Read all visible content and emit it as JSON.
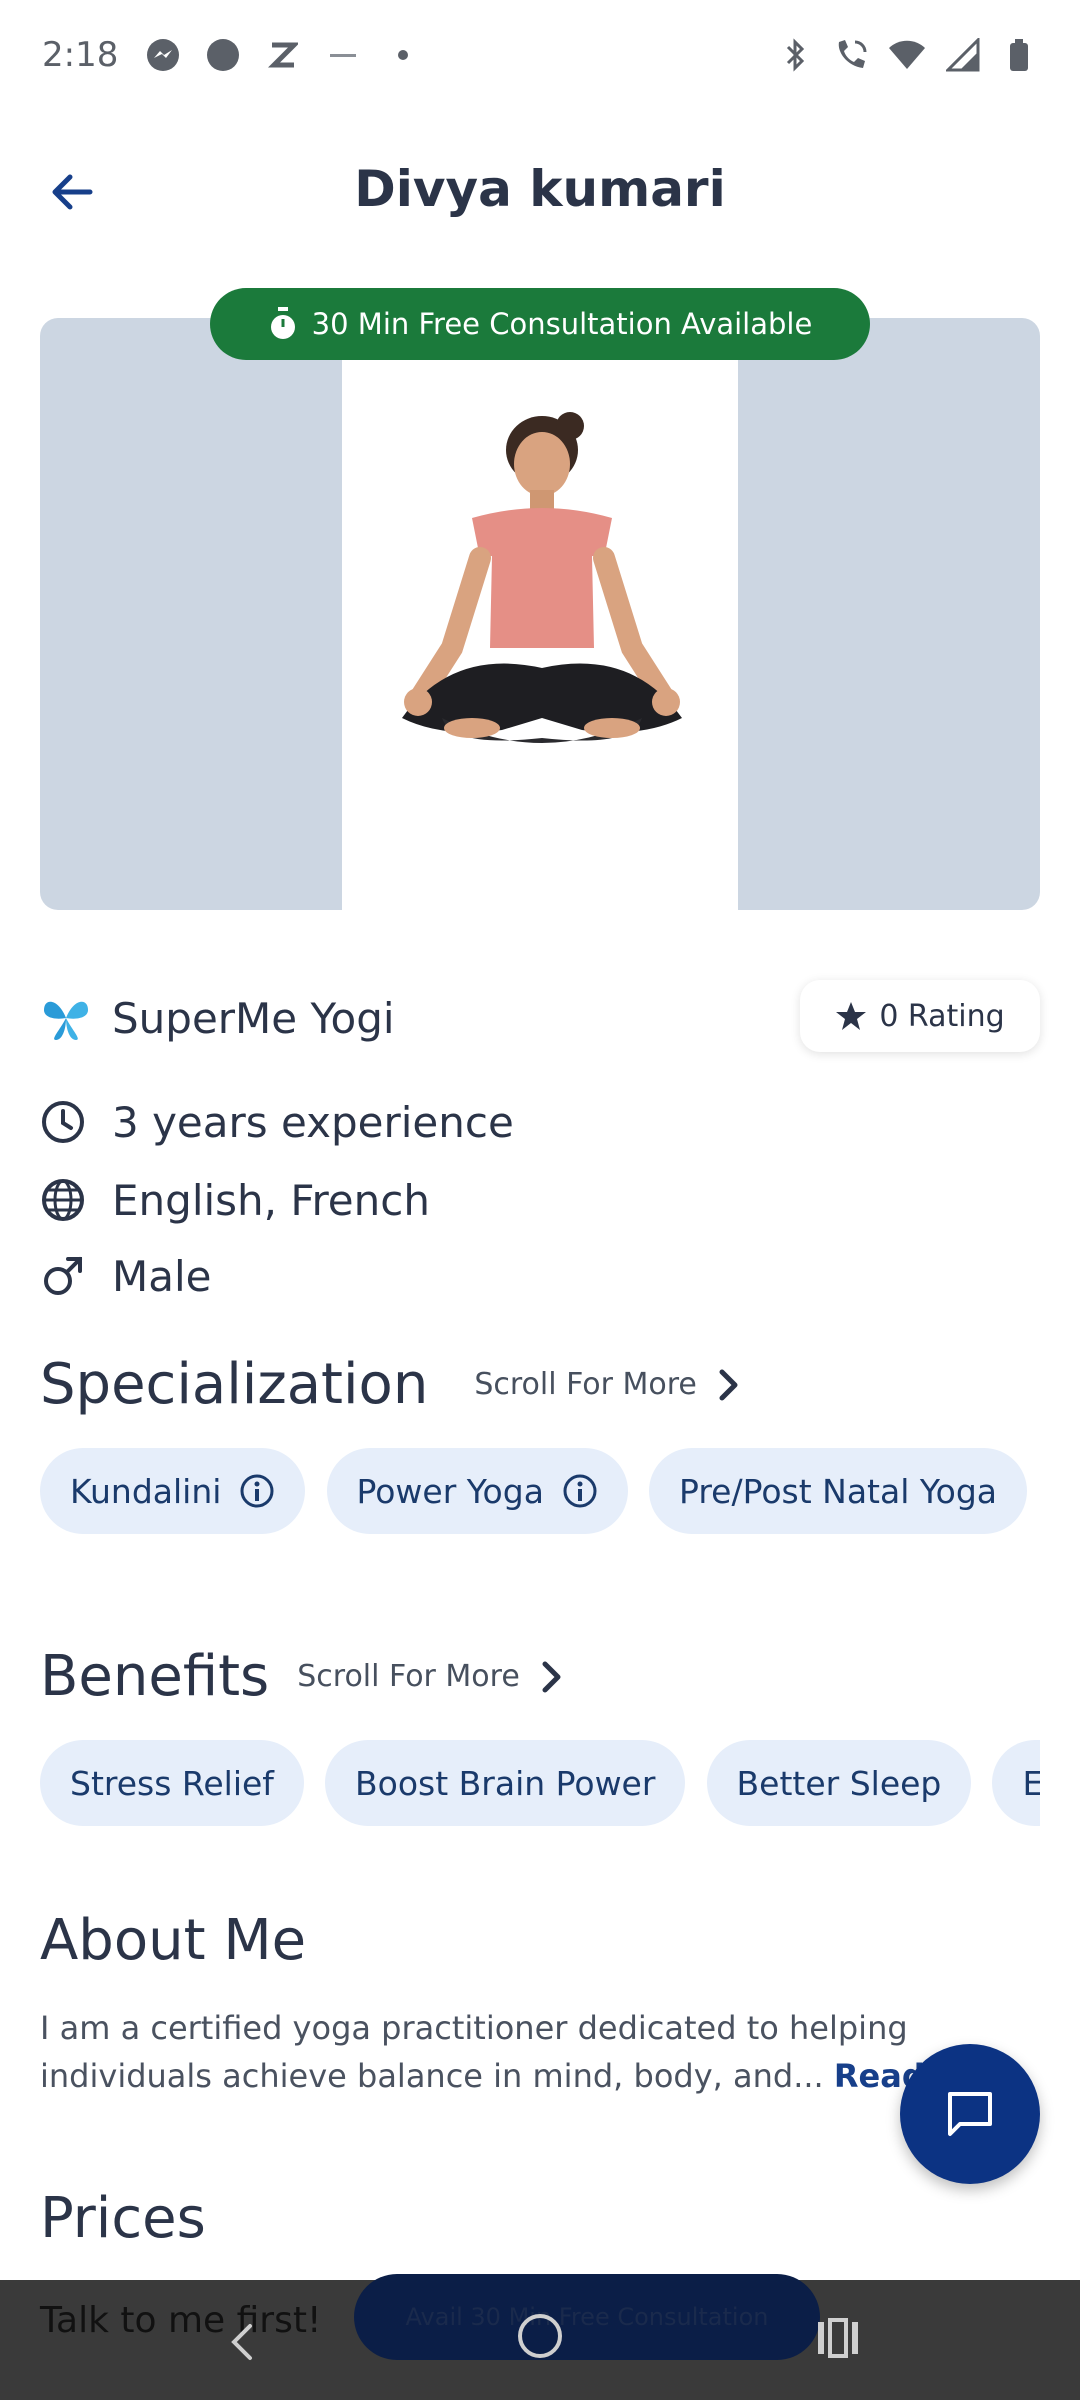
{
  "status_bar": {
    "time": "2:18",
    "left_icons": [
      "messenger-icon",
      "circle-app-icon",
      "z-app-icon",
      "rapido-icon",
      "dot-icon"
    ],
    "right_icons": [
      "bluetooth-icon",
      "call-wifi-icon",
      "wifi-icon",
      "signal-icon",
      "battery-icon"
    ]
  },
  "header": {
    "title": "Divya kumari",
    "back_icon": "arrow-left-icon"
  },
  "hero": {
    "badge_text": "30 Min Free Consultation Available",
    "badge_icon": "stopwatch-icon",
    "badge_color": "#1b7a3b"
  },
  "provider": {
    "name": "SuperMe Yogi",
    "rating_label": "0 Rating"
  },
  "info": {
    "experience": "3 years experience",
    "languages": "English, French",
    "gender": "Male"
  },
  "specialization": {
    "title": "Specialization",
    "scroll_label": "Scroll For More",
    "chips": [
      "Kundalini",
      "Power Yoga",
      "Pre/Post Natal Yoga"
    ]
  },
  "benefits": {
    "title": "Benefits",
    "scroll_label": "Scroll For More",
    "chips": [
      "Stress Relief",
      "Boost Brain Power",
      "Better Sleep",
      "En"
    ]
  },
  "about": {
    "title": "About Me",
    "text": "I am a certified yoga practitioner dedicated to helping individuals achieve balance in mind, body, and... ",
    "read_more": "Read more"
  },
  "prices": {
    "title": "Prices"
  },
  "bottom": {
    "talk_text": "Talk to me first!",
    "avail_button": "Avail 30 Min Free Consultation"
  },
  "colors": {
    "primary": "#0c3383",
    "chip_bg": "#e6eefa",
    "badge_green": "#1b7a3b"
  }
}
